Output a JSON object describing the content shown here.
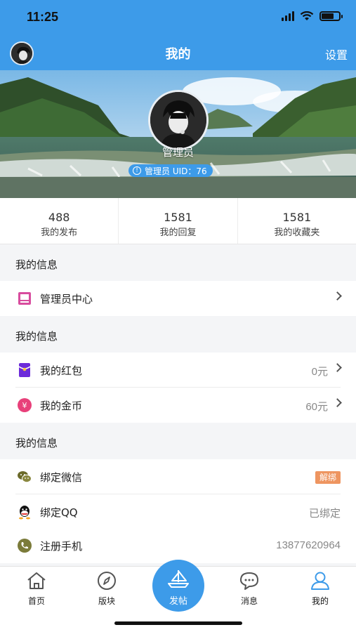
{
  "status_bar": {
    "time": "11:25"
  },
  "nav": {
    "title": "我的",
    "settings_label": "设置"
  },
  "profile": {
    "nickname": "管理员",
    "badge_text": "管理员 UID：76"
  },
  "stats": [
    {
      "value": "488",
      "label": "我的发布"
    },
    {
      "value": "1581",
      "label": "我的回复"
    },
    {
      "value": "1581",
      "label": "我的收藏夹"
    }
  ],
  "sections": [
    {
      "title": "我的信息",
      "rows": [
        {
          "label": "管理员中心",
          "icon": "admin-center-icon"
        }
      ]
    },
    {
      "title": "我的信息",
      "rows": [
        {
          "label": "我的红包",
          "value": "0元",
          "icon": "red-packet-icon"
        },
        {
          "label": "我的金币",
          "value": "60元",
          "icon": "coin-icon"
        }
      ]
    },
    {
      "title": "我的信息",
      "rows": [
        {
          "label": "绑定微信",
          "action": "解绑",
          "icon": "wechat-icon"
        },
        {
          "label": "绑定QQ",
          "value": "已绑定",
          "icon": "qq-icon"
        },
        {
          "label": "注册手机",
          "value": "13877620964",
          "icon": "phone-icon"
        }
      ]
    }
  ],
  "tabbar": {
    "home": "首页",
    "boards": "版块",
    "post": "发帖",
    "messages": "消息",
    "mine": "我的"
  },
  "colors": {
    "primary": "#3d9be9",
    "unbind": "#ee9560",
    "coin": "#e8407a",
    "admin": "#d84c9e",
    "packet": "#6c2bd9"
  }
}
